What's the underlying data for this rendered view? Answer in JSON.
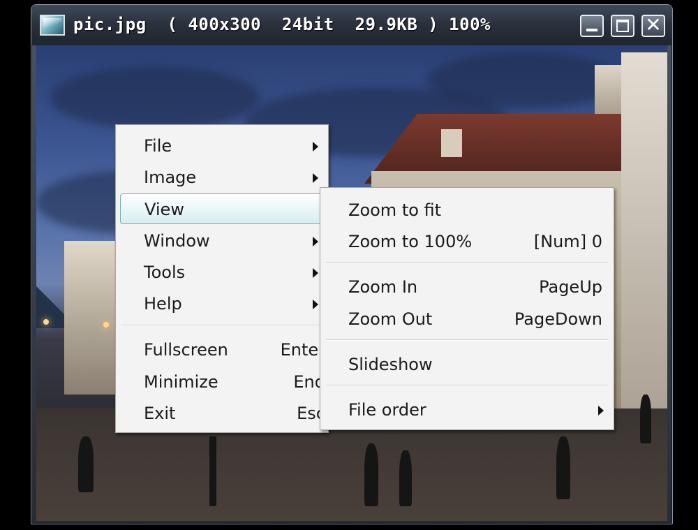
{
  "window": {
    "title": "pic.jpg  ( 400x300  24bit  29.9KB ) 100%"
  },
  "icons": {
    "app": "image-file-icon",
    "minimize": "minimize-icon",
    "maximize": "maximize-icon",
    "close": "close-icon",
    "submenu": "chevron-right-icon"
  },
  "main_menu": {
    "items": [
      {
        "label": "File"
      },
      {
        "label": "Image"
      },
      {
        "label": "View"
      },
      {
        "label": "Window"
      },
      {
        "label": "Tools"
      },
      {
        "label": "Help"
      }
    ],
    "commands": [
      {
        "label": "Fullscreen",
        "shortcut": "Enter"
      },
      {
        "label": "Minimize",
        "shortcut": "End"
      },
      {
        "label": "Exit",
        "shortcut": "Esc"
      }
    ]
  },
  "view_submenu": {
    "zoom": [
      {
        "label": "Zoom to fit",
        "shortcut": ""
      },
      {
        "label": "Zoom to 100%",
        "shortcut": "[Num] 0"
      }
    ],
    "zoom_step": [
      {
        "label": "Zoom In",
        "shortcut": "PageUp"
      },
      {
        "label": "Zoom Out",
        "shortcut": "PageDown"
      }
    ],
    "slideshow": {
      "label": "Slideshow"
    },
    "file_order": {
      "label": "File order"
    }
  },
  "colors": {
    "highlight_border": "#6fb2b8",
    "menu_background": "#f3f3f3",
    "titlebar": "#2b323d"
  }
}
